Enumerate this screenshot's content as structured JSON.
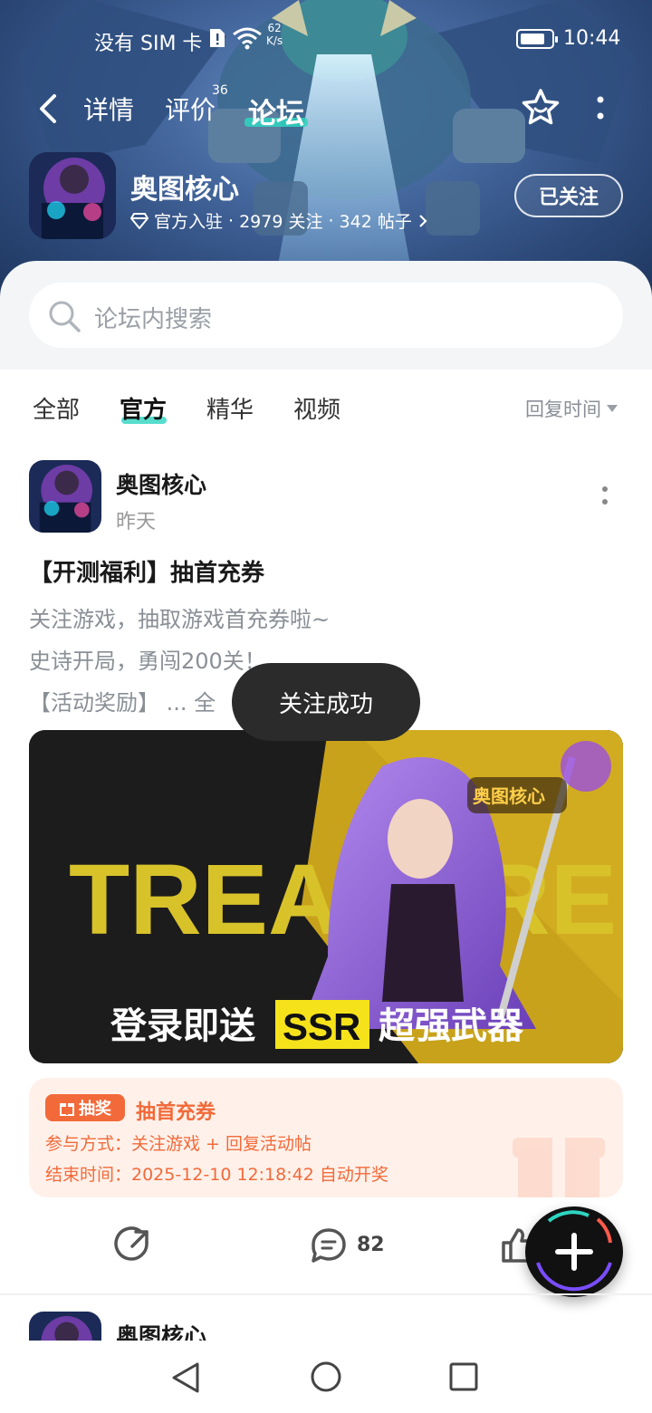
{
  "status_bar": {
    "carrier": "没有 SIM 卡",
    "speed_value": "62",
    "speed_unit": "K/s",
    "battery_level": 0.8,
    "time": "10:44"
  },
  "top_nav": {
    "back_icon": "back-arrow-icon",
    "tabs": [
      {
        "label": "详情"
      },
      {
        "label": "评价",
        "badge": "36"
      },
      {
        "label": "论坛",
        "active": true
      }
    ],
    "favorite_icon": "star-icon",
    "more_icon": "more-vertical-icon"
  },
  "game": {
    "name": "奥图核心",
    "official_label": "官方入驻",
    "followers": "2979 关注",
    "posts": "342 帖子",
    "follow_button": "已关注"
  },
  "search": {
    "placeholder": "论坛内搜索"
  },
  "filters": {
    "tabs": [
      {
        "label": "全部"
      },
      {
        "label": "官方",
        "active": true
      },
      {
        "label": "精华"
      },
      {
        "label": "视频"
      }
    ],
    "sort_label": "回复时间"
  },
  "post": {
    "author": "奥图核心",
    "date": "昨天",
    "title": "【开测福利】抽首充券",
    "lines": [
      "关注游戏，抽取游戏首充券啦~",
      "史诗开局，勇闯200关！",
      "【活动奖励】 ... 全"
    ],
    "image": {
      "big_text": "TREASURE",
      "caption_left": "登录即送",
      "caption_badge": "SSR",
      "caption_right": "超强武器",
      "logo_text": "奥图核心"
    },
    "lottery": {
      "badge": "抽奖",
      "title": "抽首充券",
      "method": "参与方式：关注游戏 + 回复活动帖",
      "end_time": "结束时间：2025-12-10 12:18:42 自动开奖"
    },
    "actions": {
      "comment_count": "82"
    }
  },
  "next_post": {
    "author": "奥图核心"
  },
  "toast": {
    "text": "关注成功"
  },
  "colors": {
    "accent_teal": "#2ed5c0",
    "lottery_orange": "#f26a3a",
    "lottery_bg": "#fff1ea"
  }
}
